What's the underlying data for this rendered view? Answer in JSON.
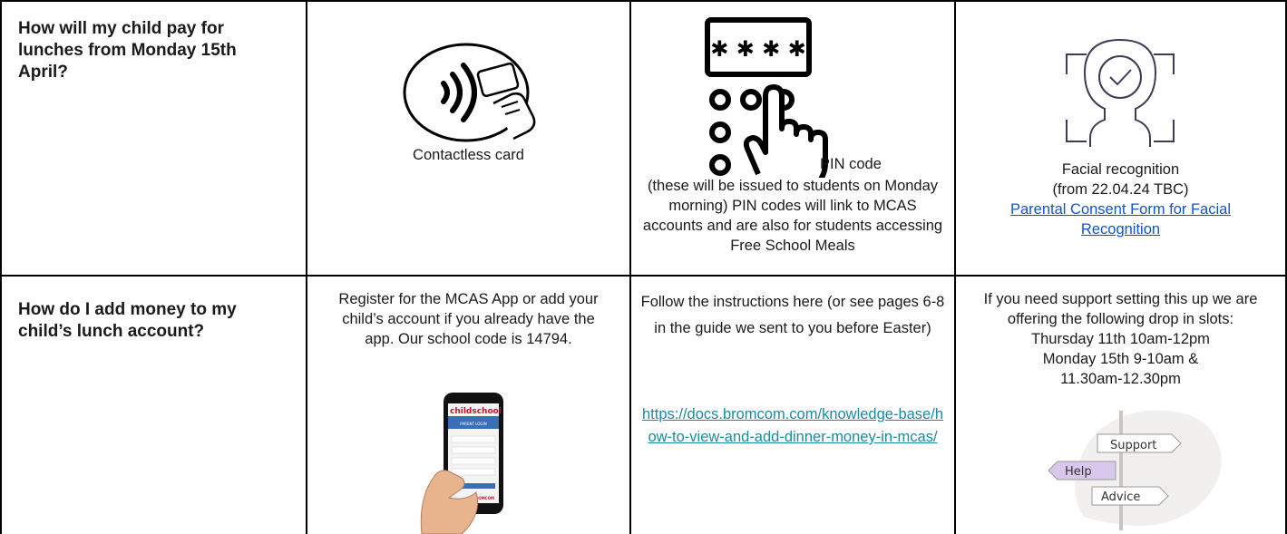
{
  "row1": {
    "question": "How will my child pay for lunches from Monday 15th April?",
    "contactless": {
      "label": "Contactless card"
    },
    "pin": {
      "keypad_code": "✱ ✱ ✱ ✱",
      "label": "PIN code",
      "description": "(these will be issued to students on Monday morning) PIN codes will link to MCAS accounts and are also for students accessing Free School Meals"
    },
    "facial": {
      "label": "Facial recognition",
      "date_note": "(from 22.04.24 TBC)",
      "consent_link": "Parental Consent Form for Facial Recognition"
    }
  },
  "row2": {
    "question": "How do I add money to my child’s lunch account?",
    "mcas": {
      "text": "Register for the MCAS App or add your child’s account if you already have the app. Our school code is 14794.",
      "phone_brand": "childschool",
      "phone_sub": "PARENT LOGIN",
      "phone_footer": "BROMCOM"
    },
    "instructions": {
      "text": "Follow the instructions here (or see pages 6-8 in the guide we sent to you before Easter)",
      "link": "https://docs.bromcom.com/knowledge-base/how-to-view-and-add-dinner-money-in-mcas/"
    },
    "support": {
      "intro": "If you need support setting this up we are offering the following drop in slots:",
      "slot1": "Thursday 11th 10am-12pm",
      "slot2a": "Monday 15th 9-10am &",
      "slot2b": "11.30am-12.30pm",
      "sign_top": "Support",
      "sign_mid": "Help",
      "sign_bottom": "Advice"
    }
  },
  "colors": {
    "link": "#1155cc",
    "link_teal": "#1a8ca0",
    "help_sign": "#d9c8ec",
    "grid": "#000000"
  }
}
